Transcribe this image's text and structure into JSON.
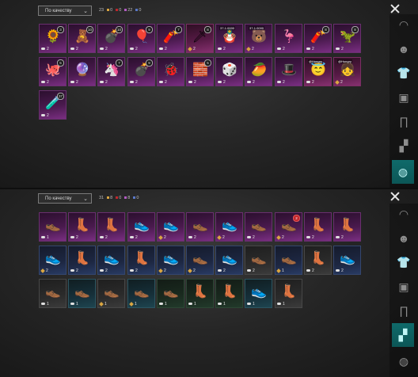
{
  "colors": {
    "accent_teal": "#0f6a6a",
    "rarity_orange": "#d9a541",
    "rarity_purple": "#7a2e82",
    "rarity_pink": "#86306f",
    "rarity_blue": "#283a63"
  },
  "top_panel": {
    "sort_label": "По качеству",
    "counts": [
      {
        "value": "23",
        "color": ""
      },
      {
        "value": "0",
        "color": "#d9a541"
      },
      {
        "value": "0",
        "color": "#c2262c"
      },
      {
        "value": "22",
        "color": "#b35cc4"
      },
      {
        "value": "0",
        "color": "#5a78c8"
      }
    ],
    "sidebar": [
      {
        "name": "sidebar-hat-icon",
        "glyph": "◠"
      },
      {
        "name": "sidebar-mask-icon",
        "glyph": "☻"
      },
      {
        "name": "sidebar-shirt-icon",
        "glyph": "👕"
      },
      {
        "name": "sidebar-backpack-icon",
        "glyph": "▣"
      },
      {
        "name": "sidebar-pants-icon",
        "glyph": "∏"
      },
      {
        "name": "sidebar-shoes-icon",
        "glyph": "▞"
      },
      {
        "name": "sidebar-charm-icon",
        "glyph": "◍",
        "active": true
      }
    ],
    "items": [
      {
        "q": "purple",
        "art": "🌻",
        "cnt": "2",
        "icon": "cloud",
        "badge": "3"
      },
      {
        "q": "purple",
        "art": "🧸",
        "cnt": "2",
        "icon": "cloud",
        "badge": "10"
      },
      {
        "q": "purple",
        "art": "💣",
        "cnt": "2",
        "icon": "cloud",
        "badge": "10"
      },
      {
        "q": "purple",
        "art": "🎈",
        "cnt": "2",
        "icon": "cloud",
        "badge": "9"
      },
      {
        "q": "purple",
        "art": "🧨",
        "cnt": "2",
        "icon": "cloud",
        "badge": "7"
      },
      {
        "q": "pink",
        "art": "🗡",
        "cnt": "2",
        "icon": "diamond",
        "badge": "8"
      },
      {
        "q": "purple",
        "art": "🪆",
        "cnt": "2",
        "icon": "cloud",
        "tag": "37-1.0000"
      },
      {
        "q": "purple",
        "art": "🐻",
        "cnt": "2",
        "icon": "diamond",
        "tag": "37-1.0000"
      },
      {
        "q": "purple",
        "art": "🦩",
        "cnt": "2",
        "icon": "cloud"
      },
      {
        "q": "purple",
        "art": "🧨",
        "cnt": "2",
        "icon": "cloud",
        "badge": "8"
      },
      {
        "q": "purple",
        "art": "🦖",
        "cnt": "2",
        "icon": "cloud",
        "badge": "8"
      },
      {
        "q": "purple",
        "art": "🐙",
        "cnt": "2",
        "icon": "cloud",
        "badge": "5"
      },
      {
        "q": "purple",
        "art": "🔮",
        "cnt": "2",
        "icon": "cloud"
      },
      {
        "q": "purple",
        "art": "🦄",
        "cnt": "2",
        "icon": "cloud",
        "badge": "7"
      },
      {
        "q": "purple",
        "art": "💣",
        "cnt": "2",
        "icon": "cloud",
        "badge": "9"
      },
      {
        "q": "purple",
        "art": "🐞",
        "cnt": "2",
        "icon": "cloud"
      },
      {
        "q": "purple",
        "art": "🧱",
        "cnt": "2",
        "icon": "cloud",
        "badge": "5"
      },
      {
        "q": "purple",
        "art": "🎲",
        "cnt": "2",
        "icon": "cloud"
      },
      {
        "q": "purple",
        "art": "🥭",
        "cnt": "2",
        "icon": "cloud"
      },
      {
        "q": "purple",
        "art": "🎩",
        "cnt": "2",
        "icon": "cloud"
      },
      {
        "q": "pink",
        "art": "😇",
        "cnt": "2",
        "icon": "cloud",
        "tag": "@Hungry"
      },
      {
        "q": "pink",
        "art": "👧",
        "cnt": "2",
        "icon": "diamond",
        "tag": "@Hungry"
      },
      {
        "q": "purple",
        "art": "🧪",
        "cnt": "2",
        "icon": "cloud",
        "badge": "37"
      }
    ]
  },
  "bottom_panel": {
    "sort_label": "По качеству",
    "counts": [
      {
        "value": "31",
        "color": ""
      },
      {
        "value": "8",
        "color": "#d9a541"
      },
      {
        "value": "0",
        "color": "#c2262c"
      },
      {
        "value": "8",
        "color": "#b35cc4"
      },
      {
        "value": "0",
        "color": "#5a78c8"
      }
    ],
    "sidebar": [
      {
        "name": "sidebar-hat-icon",
        "glyph": "◠"
      },
      {
        "name": "sidebar-mask-icon",
        "glyph": "☻"
      },
      {
        "name": "sidebar-shirt-icon",
        "glyph": "👕"
      },
      {
        "name": "sidebar-backpack-icon",
        "glyph": "▣"
      },
      {
        "name": "sidebar-pants-icon",
        "glyph": "∏"
      },
      {
        "name": "sidebar-shoes-icon",
        "glyph": "▞",
        "active": true
      },
      {
        "name": "sidebar-charm-icon",
        "glyph": "◍"
      }
    ],
    "items": [
      {
        "q": "purple",
        "art": "👞",
        "cnt": "1",
        "icon": "cloud"
      },
      {
        "q": "purple",
        "art": "👢",
        "cnt": "2",
        "icon": "cloud"
      },
      {
        "q": "purple",
        "art": "👢",
        "cnt": "2",
        "icon": "cloud"
      },
      {
        "q": "purple",
        "art": "👟",
        "cnt": "2",
        "icon": "cloud"
      },
      {
        "q": "purple",
        "art": "👟",
        "cnt": "2",
        "icon": "diamond"
      },
      {
        "q": "purple",
        "art": "👞",
        "cnt": "2",
        "icon": "cloud"
      },
      {
        "q": "purple",
        "art": "👟",
        "cnt": "2",
        "icon": "diamond"
      },
      {
        "q": "purple",
        "art": "👞",
        "cnt": "2",
        "icon": "cloud"
      },
      {
        "q": "purple",
        "art": "👞",
        "cnt": "2",
        "icon": "diamond",
        "badge": "2",
        "red": true
      },
      {
        "q": "purple",
        "art": "👢",
        "cnt": "2",
        "icon": "cloud"
      },
      {
        "q": "purple",
        "art": "👢",
        "cnt": "2",
        "icon": "cloud"
      },
      {
        "q": "blue",
        "art": "👟",
        "cnt": "2",
        "icon": "diamond"
      },
      {
        "q": "blue",
        "art": "👢",
        "cnt": "2",
        "icon": "cloud"
      },
      {
        "q": "blue",
        "art": "👟",
        "cnt": "2",
        "icon": "cloud"
      },
      {
        "q": "blue",
        "art": "👢",
        "cnt": "2",
        "icon": "cloud"
      },
      {
        "q": "blue",
        "art": "👟",
        "cnt": "2",
        "icon": "diamond"
      },
      {
        "q": "blue",
        "art": "👞",
        "cnt": "2",
        "icon": "diamond"
      },
      {
        "q": "blue",
        "art": "👟",
        "cnt": "2",
        "icon": "cloud"
      },
      {
        "q": "dark",
        "art": "👞",
        "cnt": "2",
        "icon": "cloud"
      },
      {
        "q": "blue",
        "art": "👞",
        "cnt": "1",
        "icon": "diamond"
      },
      {
        "q": "dark",
        "art": "👢",
        "cnt": "2",
        "icon": "cloud"
      },
      {
        "q": "blue",
        "art": "👟",
        "cnt": "2",
        "icon": "cloud"
      },
      {
        "q": "dark",
        "art": "👞",
        "cnt": "1",
        "icon": "cloud"
      },
      {
        "q": "teal",
        "art": "👞",
        "cnt": "1",
        "icon": "cloud"
      },
      {
        "q": "dark",
        "art": "👞",
        "cnt": "1",
        "icon": "diamond"
      },
      {
        "q": "teal",
        "art": "👞",
        "cnt": "1",
        "icon": "diamond"
      },
      {
        "q": "green",
        "art": "👞",
        "cnt": "1",
        "icon": "cloud"
      },
      {
        "q": "green",
        "art": "👢",
        "cnt": "1",
        "icon": "cloud"
      },
      {
        "q": "green",
        "art": "👢",
        "cnt": "1",
        "icon": "cloud"
      },
      {
        "q": "teal",
        "art": "👟",
        "cnt": "1",
        "icon": "cloud"
      },
      {
        "q": "dark",
        "art": "👢",
        "cnt": "1",
        "icon": "cloud"
      }
    ]
  }
}
